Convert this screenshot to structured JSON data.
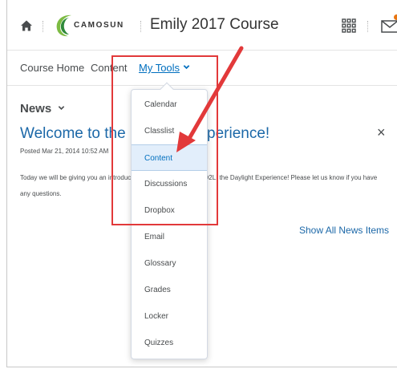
{
  "header": {
    "logo_text": "CAMOSUN",
    "course_title": "Emily 2017 Course"
  },
  "nav": {
    "items": [
      {
        "label": "Course Home"
      },
      {
        "label": "Content"
      },
      {
        "label": "My Tools"
      }
    ]
  },
  "news": {
    "heading": "News",
    "title": "Welcome to the Daylight Experience!",
    "posted": "Posted Mar 21, 2014 10:52 AM",
    "body": "Today we will be giving you an introduction to the new version of D2L, the Daylight Experience! Please let us know if you have any questions.",
    "show_all": "Show All News Items"
  },
  "dropdown": {
    "items": [
      {
        "label": "Calendar"
      },
      {
        "label": "Classlist"
      },
      {
        "label": "Content"
      },
      {
        "label": "Discussions"
      },
      {
        "label": "Dropbox"
      },
      {
        "label": "Email"
      },
      {
        "label": "Glossary"
      },
      {
        "label": "Grades"
      },
      {
        "label": "Locker"
      },
      {
        "label": "Quizzes"
      }
    ],
    "highlighted": "Content"
  },
  "colors": {
    "accent": "#006fbf",
    "link": "#1c68a8",
    "annotation": "#e2393a",
    "notification": "#e87511"
  }
}
